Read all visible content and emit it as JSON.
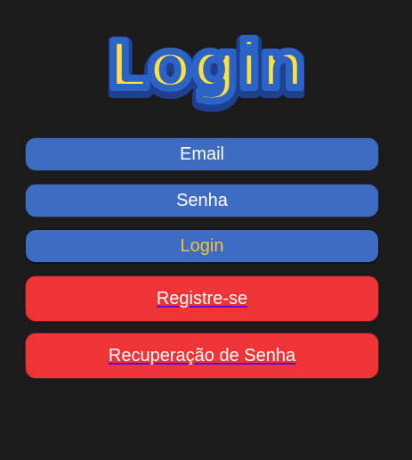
{
  "logo": {
    "text": "Login",
    "fill": "#ffe03d",
    "stroke": "#2c63c7",
    "shadow": "#1f3f8f"
  },
  "form": {
    "email_label": "Email",
    "senha_label": "Senha",
    "login_label": "Login",
    "registro_label": "Registre-se",
    "recuperacao_label": "Recuperação de Senha"
  },
  "colors": {
    "background": "#1b1b1b",
    "blue": "#3f6cc3",
    "red": "#ef3437",
    "login_text": "#f4c241"
  }
}
